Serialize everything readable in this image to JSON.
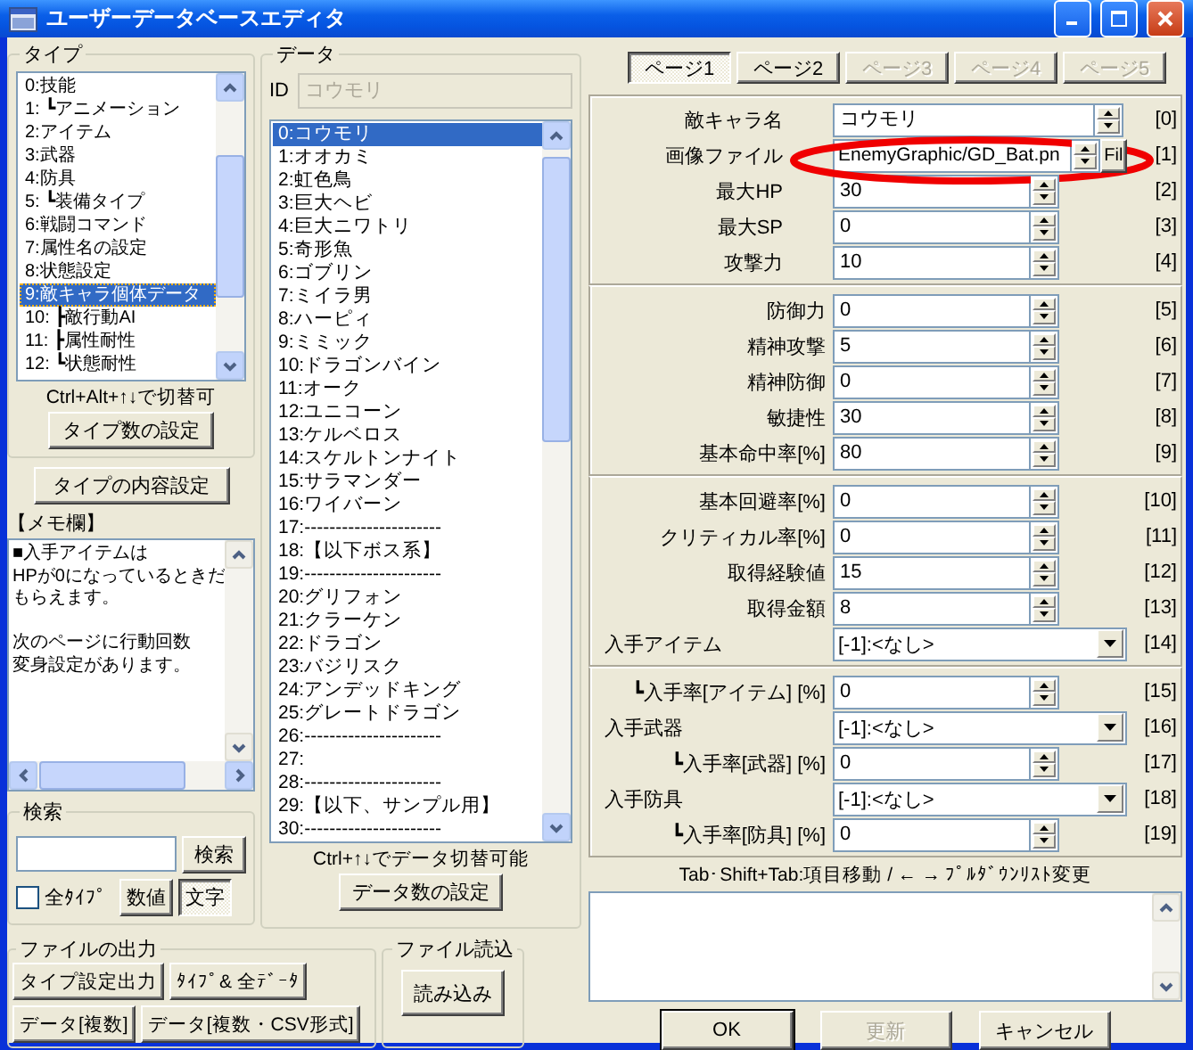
{
  "window": {
    "title": "ユーザーデータベースエディタ"
  },
  "type_group": {
    "label": "タイプ",
    "items": [
      {
        "label": "0:技能",
        "selected": false
      },
      {
        "label": "1: ┗アニメーション",
        "selected": false
      },
      {
        "label": "2:アイテム",
        "selected": false
      },
      {
        "label": "3:武器",
        "selected": false
      },
      {
        "label": "4:防具",
        "selected": false
      },
      {
        "label": "5: ┗装備タイプ",
        "selected": false
      },
      {
        "label": "6:戦闘コマンド",
        "selected": false
      },
      {
        "label": "7:属性名の設定",
        "selected": false
      },
      {
        "label": "8:状態設定",
        "selected": false
      },
      {
        "label": "9:敵キャラ個体データ",
        "selected": true
      },
      {
        "label": "10: ┣敵行動AI",
        "selected": false
      },
      {
        "label": "11: ┣属性耐性",
        "selected": false
      },
      {
        "label": "12: ┗状態耐性",
        "selected": false
      }
    ],
    "hint": "Ctrl+Alt+↑↓で切替可",
    "button": "タイプ数の設定"
  },
  "content_button": "タイプの内容設定",
  "memo": {
    "label": "【メモ欄】",
    "paragraphs": [
      [
        "■入手アイテムは",
        "HPが0になっているときだ",
        "もらえます。"
      ],
      [
        "次のページに行動回数",
        "変身設定があります。"
      ]
    ]
  },
  "search": {
    "label": "検索",
    "button": "検索",
    "all_types": {
      "label": "全ﾀｲﾌﾟ",
      "checked": false
    },
    "modes": [
      {
        "label": "数値",
        "selected": false
      },
      {
        "label": "文字",
        "selected": true
      }
    ]
  },
  "output": {
    "label": "ファイルの出力",
    "buttons": [
      "タイプ設定出力",
      "ﾀｲﾌﾟ& 全ﾃﾞｰﾀ",
      "データ[複数]",
      "データ[複数・CSV形式]"
    ]
  },
  "data_group": {
    "label": "データ",
    "id_label": "ID",
    "id_value": "コウモリ",
    "items": [
      {
        "label": "0:コウモリ",
        "selected": true
      },
      {
        "label": "1:オオカミ",
        "selected": false
      },
      {
        "label": "2:虹色鳥",
        "selected": false
      },
      {
        "label": "3:巨大ヘビ",
        "selected": false
      },
      {
        "label": "4:巨大ニワトリ",
        "selected": false
      },
      {
        "label": "5:奇形魚",
        "selected": false
      },
      {
        "label": "6:ゴブリン",
        "selected": false
      },
      {
        "label": "7:ミイラ男",
        "selected": false
      },
      {
        "label": "8:ハーピィ",
        "selected": false
      },
      {
        "label": "9:ミミック",
        "selected": false
      },
      {
        "label": "10:ドラゴンバイン",
        "selected": false
      },
      {
        "label": "11:オーク",
        "selected": false
      },
      {
        "label": "12:ユニコーン",
        "selected": false
      },
      {
        "label": "13:ケルベロス",
        "selected": false
      },
      {
        "label": "14:スケルトンナイト",
        "selected": false
      },
      {
        "label": "15:サラマンダー",
        "selected": false
      },
      {
        "label": "16:ワイバーン",
        "selected": false
      },
      {
        "label": "17:----------------------",
        "selected": false
      },
      {
        "label": "18:【以下ボス系】",
        "selected": false
      },
      {
        "label": "19:----------------------",
        "selected": false
      },
      {
        "label": "20:グリフォン",
        "selected": false
      },
      {
        "label": "21:クラーケン",
        "selected": false
      },
      {
        "label": "22:ドラゴン",
        "selected": false
      },
      {
        "label": "23:バジリスク",
        "selected": false
      },
      {
        "label": "24:アンデッドキング",
        "selected": false
      },
      {
        "label": "25:グレートドラゴン",
        "selected": false
      },
      {
        "label": "26:----------------------",
        "selected": false
      },
      {
        "label": "27:",
        "selected": false
      },
      {
        "label": "28:----------------------",
        "selected": false
      },
      {
        "label": "29:【以下、サンプル用】",
        "selected": false
      },
      {
        "label": "30:----------------------",
        "selected": false
      }
    ],
    "hint": "Ctrl+↑↓でデータ切替可能",
    "button": "データ数の設定"
  },
  "load": {
    "label": "ファイル読込",
    "button": "読み込み"
  },
  "pages": [
    {
      "label": "ページ1",
      "selected": true,
      "disabled": false
    },
    {
      "label": "ページ2",
      "selected": false,
      "disabled": false
    },
    {
      "label": "ページ3",
      "selected": false,
      "disabled": true
    },
    {
      "label": "ページ4",
      "selected": false,
      "disabled": true
    },
    {
      "label": "ページ5",
      "selected": false,
      "disabled": true
    }
  ],
  "sections": [
    {
      "rows": [
        {
          "kind": "text",
          "label": "敵キャラ名",
          "value": "コウモリ",
          "index": "[0]"
        },
        {
          "kind": "file",
          "label": "画像ファイル",
          "value": "EnemyGraphic/GD_Bat.pn",
          "button": "Fil",
          "index": "[1]"
        },
        {
          "kind": "number",
          "label": "最大HP",
          "value": "30",
          "index": "[2]"
        },
        {
          "kind": "number",
          "label": "最大SP",
          "value": "0",
          "index": "[3]"
        },
        {
          "kind": "number",
          "label": "攻撃力",
          "value": "10",
          "index": "[4]"
        }
      ]
    },
    {
      "rows": [
        {
          "kind": "number",
          "label": "防御力",
          "value": "0",
          "index": "[5]"
        },
        {
          "kind": "number",
          "label": "精神攻撃",
          "value": "5",
          "index": "[6]"
        },
        {
          "kind": "number",
          "label": "精神防御",
          "value": "0",
          "index": "[7]"
        },
        {
          "kind": "number",
          "label": "敏捷性",
          "value": "30",
          "index": "[8]"
        },
        {
          "kind": "number",
          "label": "基本命中率[%]",
          "value": "80",
          "index": "[9]"
        }
      ]
    },
    {
      "rows": [
        {
          "kind": "number",
          "label": "基本回避率[%]",
          "value": "0",
          "index": "[10]"
        },
        {
          "kind": "number",
          "label": "クリティカル率[%]",
          "value": "0",
          "index": "[11]"
        },
        {
          "kind": "number",
          "label": "取得経験値",
          "value": "15",
          "index": "[12]"
        },
        {
          "kind": "number",
          "label": "取得金額",
          "value": "8",
          "index": "[13]"
        },
        {
          "kind": "select",
          "label": "入手アイテム",
          "value": "[-1]:<なし>",
          "index": "[14]"
        }
      ]
    },
    {
      "rows": [
        {
          "kind": "number",
          "label": "┗入手率[アイテム] [%]",
          "value": "0",
          "index": "[15]"
        },
        {
          "kind": "select",
          "label": "入手武器",
          "value": "[-1]:<なし>",
          "index": "[16]"
        },
        {
          "kind": "number",
          "label": "┗入手率[武器] [%]",
          "value": "0",
          "index": "[17]"
        },
        {
          "kind": "select",
          "label": "入手防具",
          "value": "[-1]:<なし>",
          "index": "[18]"
        },
        {
          "kind": "number",
          "label": "┗入手率[防具] [%]",
          "value": "0",
          "index": "[19]"
        }
      ]
    }
  ],
  "form_hint": "Tab･Shift+Tab:項目移動 / ← → ﾌﾟﾙﾀﾞｳﾝﾘｽﾄ変更",
  "footer_buttons": [
    {
      "label": "OK",
      "disabled": false
    },
    {
      "label": "更新",
      "disabled": true
    },
    {
      "label": "キャンセル",
      "disabled": false
    }
  ]
}
